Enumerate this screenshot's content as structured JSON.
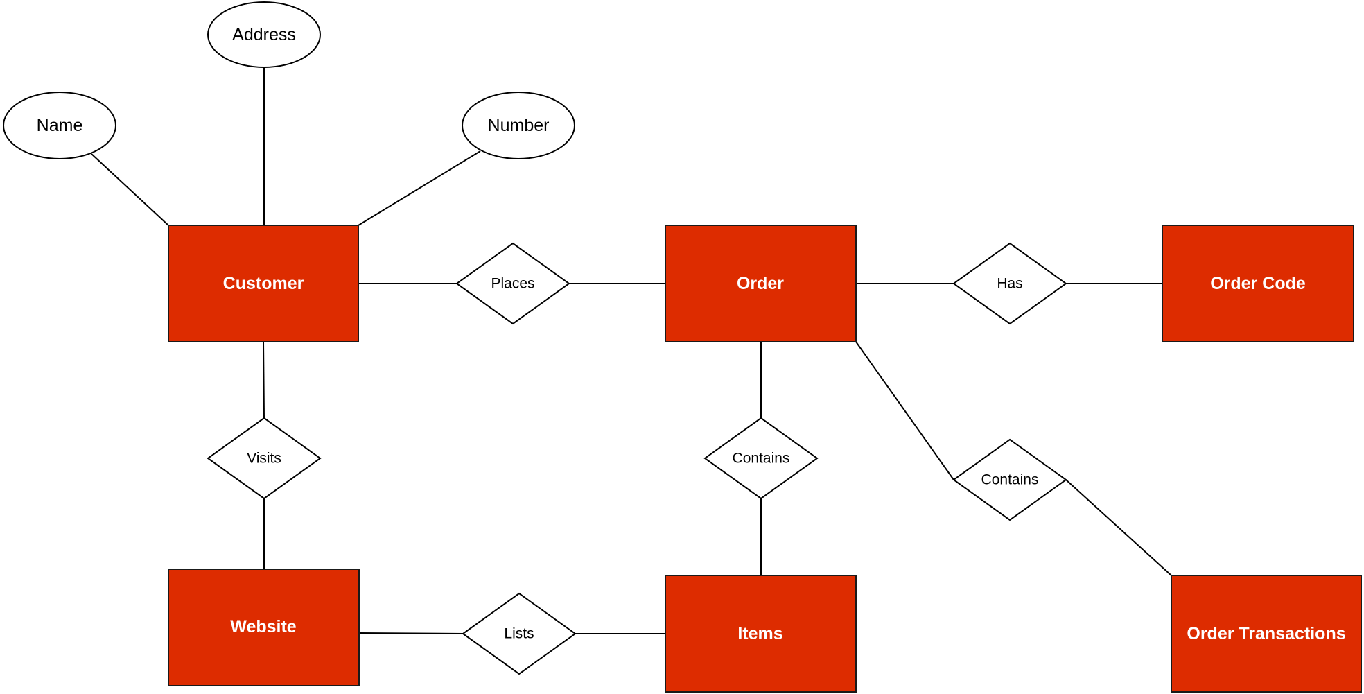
{
  "diagram": {
    "type": "er-diagram",
    "colors": {
      "entity_fill": "#DD2C00",
      "entity_text": "#FFFFFF",
      "stroke": "#000000",
      "background": "#FFFFFF"
    },
    "entities": [
      {
        "id": "customer",
        "label": "Customer"
      },
      {
        "id": "order",
        "label": "Order"
      },
      {
        "id": "order_code",
        "label": "Order Code"
      },
      {
        "id": "website",
        "label": "Website"
      },
      {
        "id": "items",
        "label": "Items"
      },
      {
        "id": "order_transactions",
        "label": "Order Transactions"
      }
    ],
    "attributes": [
      {
        "id": "name",
        "label": "Name",
        "of": "customer"
      },
      {
        "id": "address",
        "label": "Address",
        "of": "customer"
      },
      {
        "id": "number",
        "label": "Number",
        "of": "customer"
      }
    ],
    "relationships": [
      {
        "id": "places",
        "label": "Places",
        "from": "customer",
        "to": "order"
      },
      {
        "id": "has",
        "label": "Has",
        "from": "order",
        "to": "order_code"
      },
      {
        "id": "visits",
        "label": "Visits",
        "from": "customer",
        "to": "website"
      },
      {
        "id": "contains_items",
        "label": "Contains",
        "from": "order",
        "to": "items"
      },
      {
        "id": "contains_transactions",
        "label": "Contains",
        "from": "order",
        "to": "order_transactions"
      },
      {
        "id": "lists",
        "label": "Lists",
        "from": "website",
        "to": "items"
      }
    ]
  }
}
